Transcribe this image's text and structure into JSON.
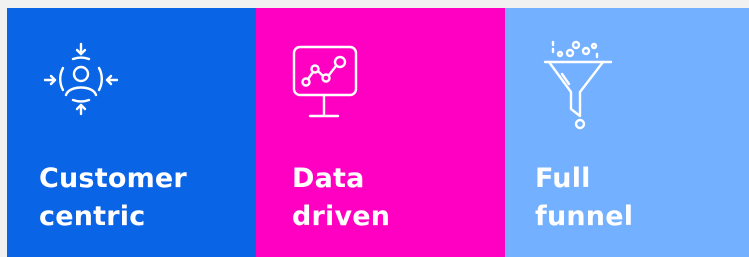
{
  "tiles": [
    {
      "line1": "Customer",
      "line2": "centric",
      "icon": "customer-centric-icon",
      "color": "#0a64e6"
    },
    {
      "line1": "Data",
      "line2": "driven",
      "icon": "data-monitor-icon",
      "color": "#ff00c3"
    },
    {
      "line1": "Full",
      "line2": "funnel",
      "icon": "funnel-icon",
      "color": "#73b0ff"
    }
  ]
}
